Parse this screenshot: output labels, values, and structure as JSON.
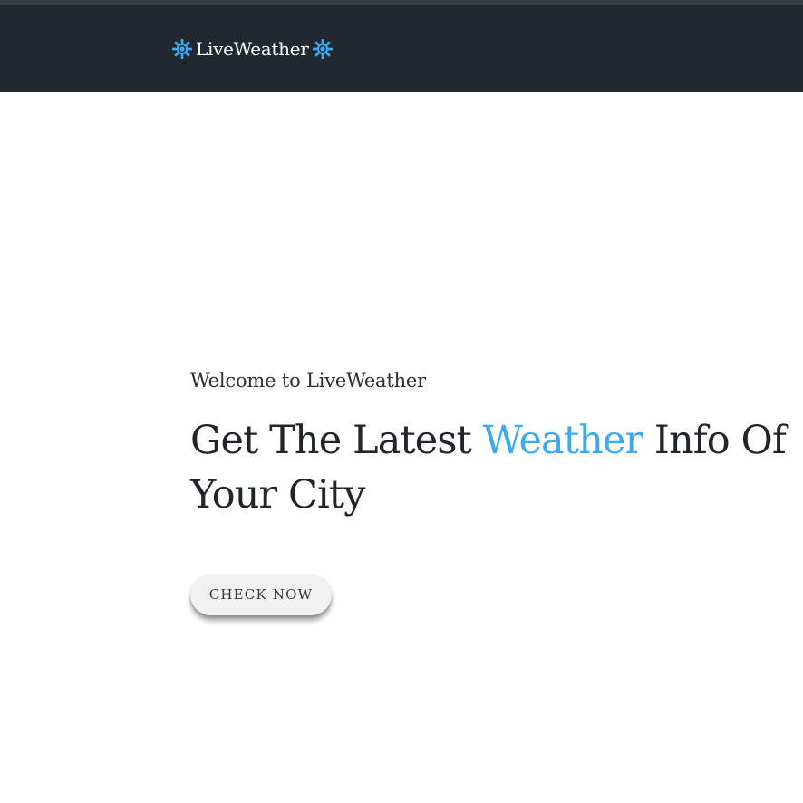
{
  "navbar": {
    "brand_label": "LiveWeather",
    "brand_icon_left": "sun-gear-icon",
    "brand_icon_right": "sun-gear-icon",
    "background_color": "#212830"
  },
  "hero": {
    "welcome_text": "Welcome to LiveWeather",
    "headline_before": "Get The Latest ",
    "headline_accent": "Weather",
    "headline_after": " Info Of Your City",
    "accent_color": "#3ea8f0",
    "cta_label": "CHECK NOW"
  }
}
